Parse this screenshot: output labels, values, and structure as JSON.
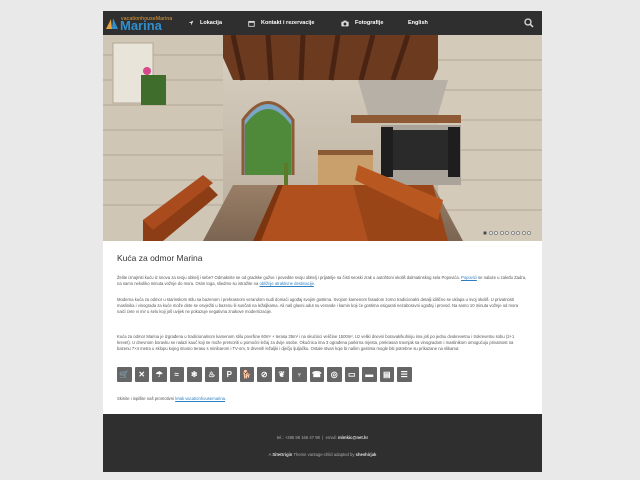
{
  "site": {
    "logo_small": "vacationhouseMarina",
    "logo_big": "Marina"
  },
  "nav": {
    "items": [
      {
        "label": "Lokacija",
        "icon": "location-arrow-icon"
      },
      {
        "label": "Kontakt i rezervacije",
        "icon": "calendar-icon"
      },
      {
        "label": "Fotografije",
        "icon": "camera-icon"
      },
      {
        "label": "English"
      }
    ],
    "search_icon": "search-icon"
  },
  "slider": {
    "dot_count": 9,
    "active_index": 0
  },
  "content": {
    "title": "Kuća za odmor Marina",
    "p1_before": "Želite iznajmiti kuću iz snova za svoju obitelj i sebe? Odmaknite se od gradske gužve i povedite svoju obitelj i prijatelje na čisti seoski zrak u autohtoni okoliš dalmatinskog sela Popovića. ",
    "p1_link1": "Popovići",
    "p1_mid": " se nalaze u zaleđu Zadra, na samo nekoliko minuta vožnje do mora. Osim toga, sliedmo su istražite na ",
    "p1_link2": "obližnje atraktivne destinacije",
    "p1_end": ".",
    "p2": "Moderna kuća za odmor u starinskom stilu sa bazenom i prekrasnom verandom nudi domaći ugođaj svojim gostima. Svojom kamenom fasadom zorno tradicionalni detalji idilično se uklapa u svoj okoliš. U privatnosti maslinika i vinograda za kuće može dete se osvježiti u bazenu ili sunčati na ležaljkama. Ali naš glavni adut su verande i kamin koji će gostima osigurati nezaboravni ugođaj i provod. Na samo 10 minuta vožnje od mora naići ćete vi mir u selu koji još uvijek ne pokazuje negativna znakove modernizacije.",
    "p3": "Kuća za odmor Marina je izgrađena u tradicionalnom kamenom stilu površine 60m² + terasa 35m² i na okućnici veličine 1500m². Uz veliki dnevni boravak/kuhinju ima još po jednu dvokrevetnu i trokrevetnu sobu (2+1 krevet). U dnevnom boravku se nalazi kauč koji se može pretvoriti u pomoćni ležaj za dvije osobe. Okućnica ima 3 ograđena parkirna mjesta, prekrasan travnjak sa vinogradom i maslinikom omogućuju privatnost na bazenu 7×4 metra u sklopu kojeg imamo terasu s minibarom i TV-om, 5 drvenih ležaljki i dječju ljuljačku. Ostale stvari koje bi našim gostima mogle biti potrebne su prikazane na slikama:",
    "amenities": [
      {
        "name": "shopping-cart-icon",
        "glyph": "🛒"
      },
      {
        "name": "no-smoking-icon",
        "glyph": "✕"
      },
      {
        "name": "beach-icon",
        "glyph": "☂"
      },
      {
        "name": "pool-icon",
        "glyph": "≈"
      },
      {
        "name": "snowflake-icon",
        "glyph": "❄"
      },
      {
        "name": "heating-icon",
        "glyph": "♨"
      },
      {
        "name": "parking-icon",
        "glyph": "P"
      },
      {
        "name": "pets-icon",
        "glyph": "🐕"
      },
      {
        "name": "no-pets-icon",
        "glyph": "⊘"
      },
      {
        "name": "grapes-icon",
        "glyph": "❦"
      },
      {
        "name": "grill-icon",
        "glyph": "♆"
      },
      {
        "name": "phone-icon",
        "glyph": "☎"
      },
      {
        "name": "washing-machine-icon",
        "glyph": "◎"
      },
      {
        "name": "tv-icon",
        "glyph": "▭"
      },
      {
        "name": "bed-icon",
        "glyph": "▬"
      },
      {
        "name": "sofa-icon",
        "glyph": "▤"
      },
      {
        "name": "air-conditioning-icon",
        "glyph": "☰"
      }
    ],
    "p4_before": "Skinite i ispišite naš promotivni ",
    "p4_link": "letak vacationhousemarina",
    "p4_end": "."
  },
  "footer": {
    "tel_label": "tel.:",
    "tel": "+385 98 166 47 98",
    "sep": "|",
    "email_label": "email:",
    "email": "mlmkic@net.hr",
    "credit_prefix": "A",
    "credit_brand": "SiteOrigin",
    "credit_mid": "Theme vantage-child adapted by",
    "credit_author": "sheshirjak"
  },
  "colors": {
    "topbar": "#2f2f2f",
    "link": "#2f7fc0",
    "logo_blue": "#2f8fce",
    "logo_orange": "#e9a23b"
  }
}
